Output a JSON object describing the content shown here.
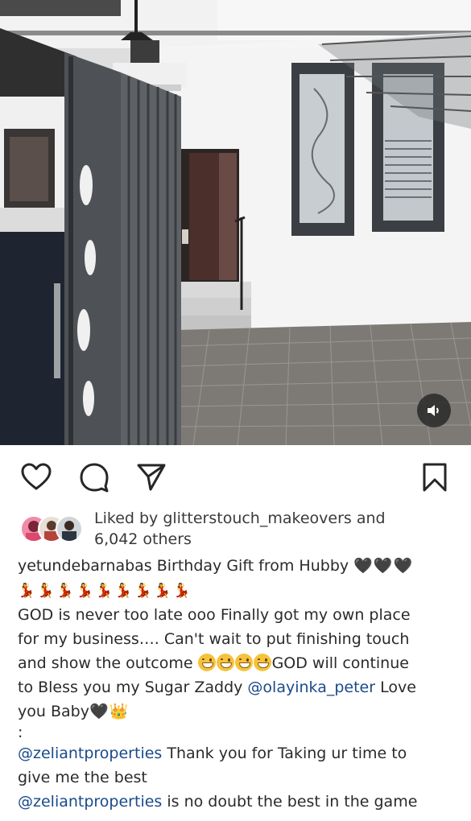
{
  "media": {
    "type": "video",
    "mute_icon": "speaker-icon"
  },
  "actions": {
    "like_icon": "heart-outline-icon",
    "comment_icon": "comment-icon",
    "share_icon": "send-icon",
    "save_icon": "bookmark-icon"
  },
  "likes": {
    "line1": "Liked by glitterstouch_makeovers and",
    "line2": "6,042 others"
  },
  "caption": {
    "username": "yetundebarnabas",
    "text1": " Birthday Gift from Hubby ",
    "hearts": "🖤🖤🖤",
    "dancers": "💃💃💃💃💃💃💃💃💃",
    "line3": "GOD is never too late ooo Finally got my own place",
    "line4": "for my business…. Can't wait to put finishing touch",
    "line5a": "and show the outcome ",
    "line5b": "GOD will continue",
    "line6a": "to Bless you my Sugar Zaddy ",
    "mention1": "@olayinka_peter",
    "line6b": " Love",
    "line7a": "you Baby",
    "line7_heart": "🖤",
    "line7_crown": "👑",
    "colon": ":",
    "mention2": "@zeliantproperties",
    "line9b": " Thank you for Taking ur time to",
    "line10": "give me the best",
    "mention3": "@zeliantproperties",
    "line11b": " is no doubt the best in the game"
  },
  "colors": {
    "mention": "#1a4a8a",
    "icon": "#262626",
    "text": "#262626"
  }
}
